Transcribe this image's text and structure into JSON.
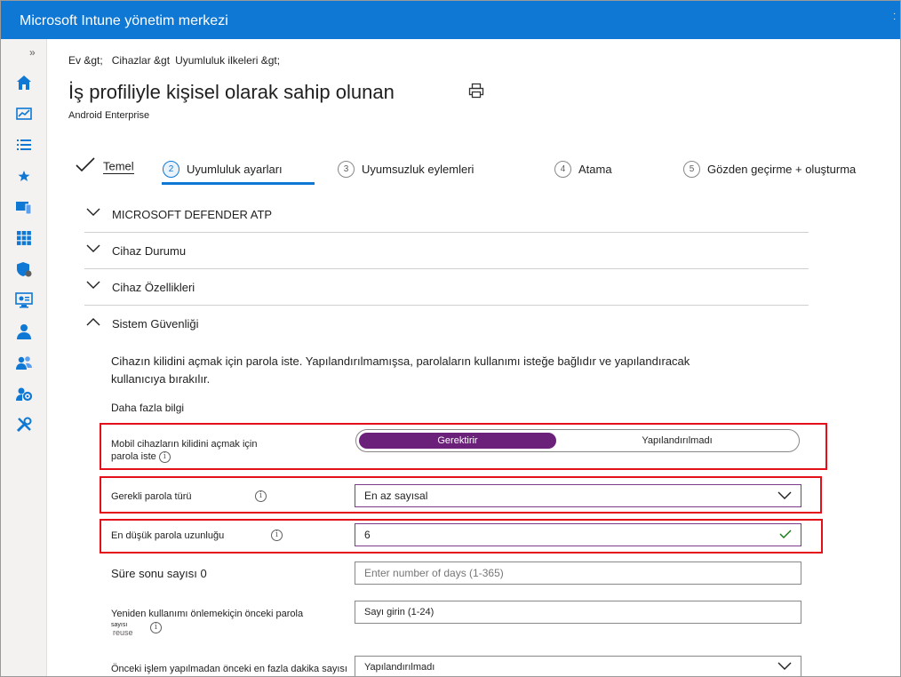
{
  "header": {
    "title": "Microsoft Intune yönetim merkezi",
    "more_label": "..."
  },
  "nav": {
    "expand_label": "»",
    "items": [
      "home-icon",
      "dashboard-icon",
      "list-icon",
      "star-icon",
      "devices-icon",
      "apps-icon",
      "endpoint-security-icon",
      "reports-icon",
      "users-icon",
      "groups-icon",
      "tenant-admin-icon",
      "troubleshoot-icon"
    ]
  },
  "breadcrumb": [
    "Ev &gt;",
    "Cihazlar &gt",
    "Uyumluluk ilkeleri &gt;"
  ],
  "page": {
    "title": "İş profiliyle kişisel olarak sahip olunan",
    "subtitle": "Android Enterprise"
  },
  "steps": [
    {
      "num": "",
      "label": "Temel"
    },
    {
      "num": "2",
      "label": "Uyumluluk ayarları"
    },
    {
      "num": "3",
      "label": "Uyumsuzluk eylemleri"
    },
    {
      "num": "4",
      "label": "Atama"
    },
    {
      "num": "5",
      "label": "Gözden geçirme + oluşturma"
    }
  ],
  "sections": [
    {
      "label": "MICROSOFT DEFENDER ATP",
      "expanded": false
    },
    {
      "label": "Cihaz Durumu",
      "expanded": false
    },
    {
      "label": "Cihaz Özellikleri",
      "expanded": false
    },
    {
      "label": "Sistem Güvenliği",
      "expanded": true
    }
  ],
  "system_security": {
    "description": "Cihazın kilidini açmak için parola iste. Yapılandırılmamışsa, parolaların kullanımı isteğe bağlıdır ve yapılandıracak kullanıcıya bırakılır.",
    "more_info": "Daha fazla bilgi",
    "require_password": {
      "label_line1": "Mobil cihazların kilidini açmak için",
      "label_line2": "parola iste",
      "on_label": "Gerektirir",
      "off_label": "Yapılandırılmadı",
      "selected": "on"
    },
    "password_type": {
      "label": "Gerekli parola türü",
      "value": "En az sayısal"
    },
    "min_length": {
      "label": "En düşük parola uzunluğu",
      "value": "6"
    },
    "expiration": {
      "label": "Süre sonu sayısı 0",
      "placeholder": "Enter number of days (1-365)"
    },
    "reuse": {
      "label_line1": "Yeniden kullanımı önlemekiçin önceki parola",
      "label_line2": "sayısı",
      "label_overlap": "reuse",
      "placeholder": "Sayı girin (1-24)"
    },
    "max_minutes": {
      "label": "Önceki işlem yapılmadan önceki en fazla dakika sayısı",
      "value": "Yapılandırılmadı"
    }
  },
  "colors": {
    "accent": "#0f78d4",
    "toggle_on": "#6b2179",
    "highlight": "#e3101a",
    "success": "#107c10"
  }
}
